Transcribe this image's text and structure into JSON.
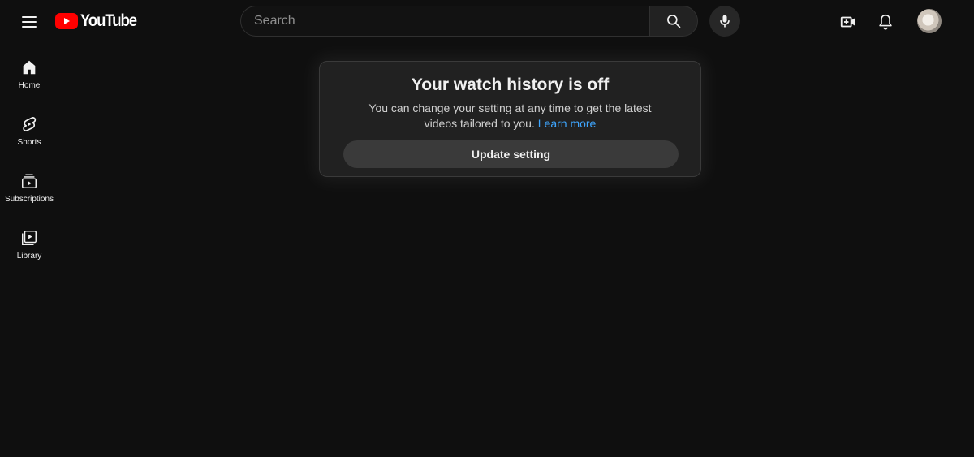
{
  "header": {
    "logo_text": "YouTube",
    "search": {
      "placeholder": "Search",
      "value": ""
    }
  },
  "sidebar": {
    "items": [
      {
        "label": "Home",
        "icon": "home-icon"
      },
      {
        "label": "Shorts",
        "icon": "shorts-icon"
      },
      {
        "label": "Subscriptions",
        "icon": "subscriptions-icon"
      },
      {
        "label": "Library",
        "icon": "library-icon"
      }
    ]
  },
  "notice": {
    "title": "Your watch history is off",
    "description": "You can change your setting at any time to get the latest videos tailored to you.",
    "link_text": "Learn more",
    "button_label": "Update setting"
  },
  "colors": {
    "background": "#0f0f0f",
    "brand_red": "#ff0000",
    "link": "#3ea6ff",
    "card": "#212121"
  }
}
